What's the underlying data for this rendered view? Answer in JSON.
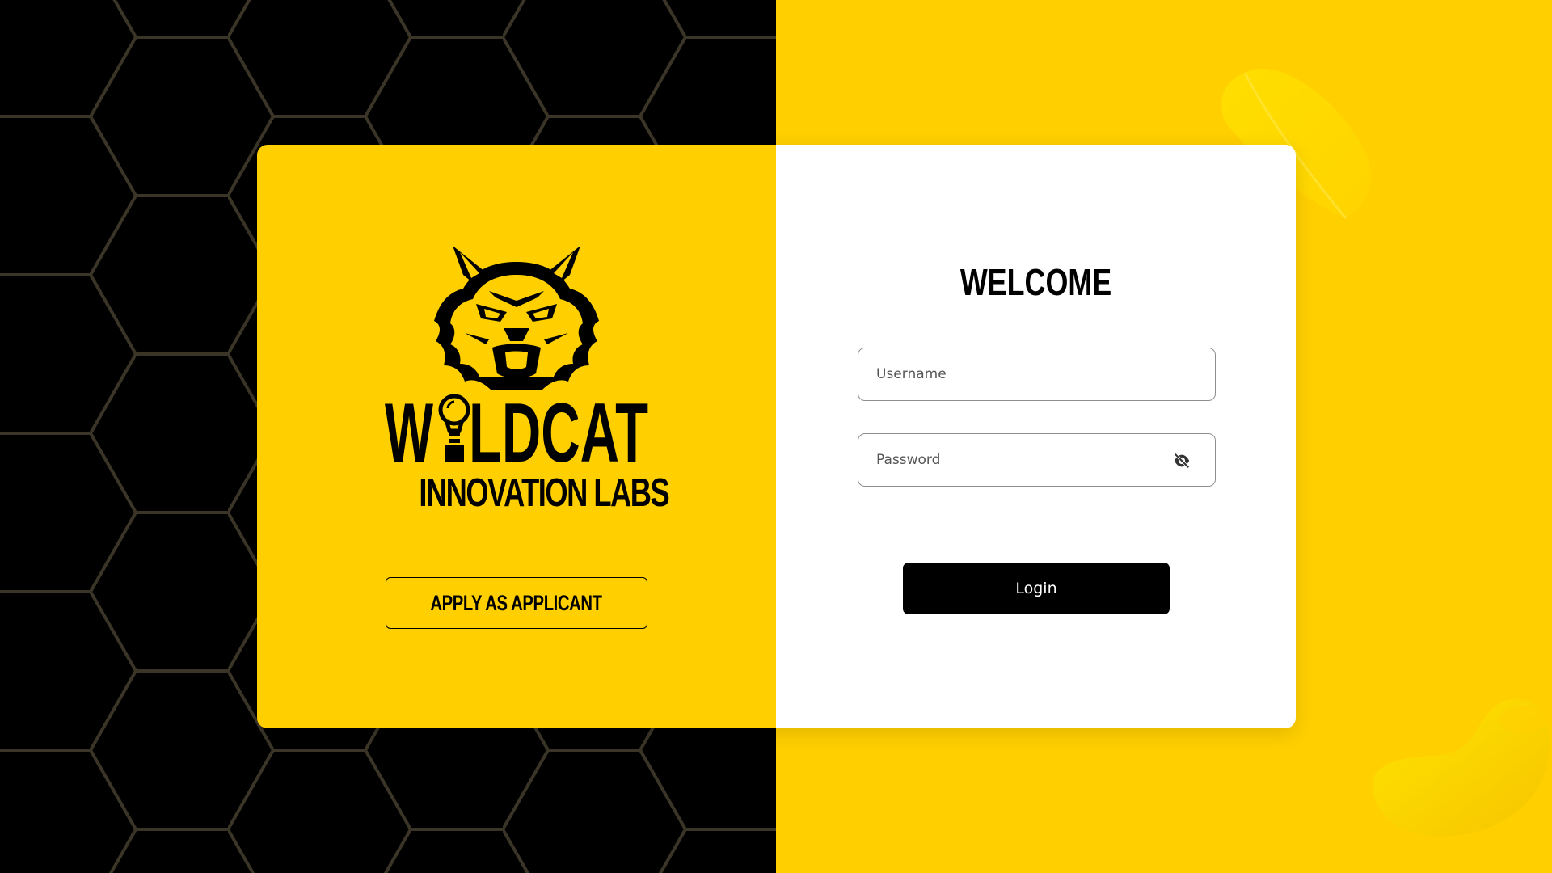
{
  "brand": {
    "word_left": "W",
    "word_right": "LDCAT",
    "subtitle": "INNOVATION LABS",
    "primary_color": "#ffcf00",
    "dark_color": "#000000",
    "logo_icon": "wildcat-head-icon",
    "bulb_icon": "lightbulb-icon"
  },
  "left_panel": {
    "apply_label": "APPLY AS APPLICANT"
  },
  "login_form": {
    "title": "WELCOME",
    "username_placeholder": "Username",
    "password_placeholder": "Password",
    "password_toggle_icon": "eye-slash-icon",
    "submit_label": "Login"
  }
}
